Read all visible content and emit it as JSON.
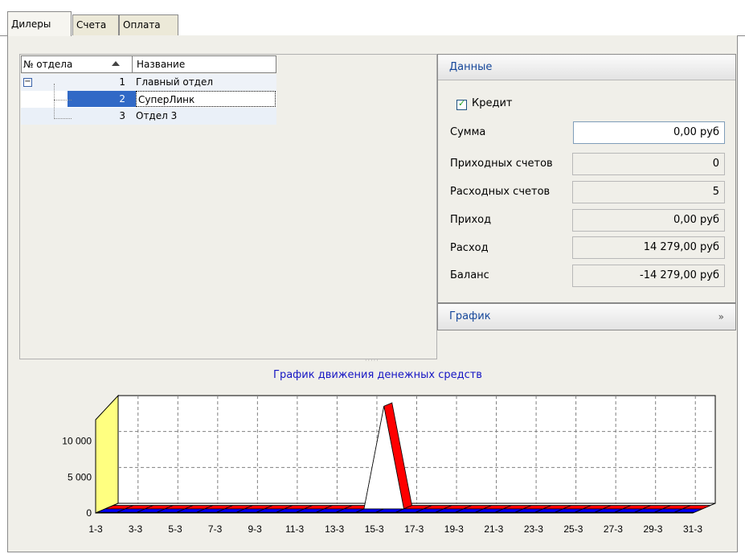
{
  "tabs": [
    "Дилеры",
    "Счета",
    "Оплата"
  ],
  "tree": {
    "columns": [
      "№ отдела",
      "Название"
    ],
    "rows": [
      {
        "num": "1",
        "name": "Главный отдел"
      },
      {
        "num": "2",
        "name": "СуперЛинк"
      },
      {
        "num": "3",
        "name": "Отдел 3"
      }
    ]
  },
  "data_group": {
    "title": "Данные",
    "credit_label": "Кредит",
    "fields": [
      {
        "label": "Сумма",
        "value": "0,00 руб"
      },
      {
        "label": "Приходных счетов",
        "value": "0"
      },
      {
        "label": "Расходных счетов",
        "value": "5"
      },
      {
        "label": "Приход",
        "value": "0,00 руб"
      },
      {
        "label": "Расход",
        "value": "14 279,00 руб"
      },
      {
        "label": "Баланс",
        "value": "-14 279,00 руб"
      }
    ]
  },
  "graph_group": {
    "title": "График"
  },
  "chart_data": {
    "type": "area",
    "title": "График движения денежных средств",
    "ylim": [
      0,
      15000
    ],
    "y_ticks": [
      "0",
      "5 000",
      "10 000"
    ],
    "categories": [
      "1-3",
      "2-3",
      "3-3",
      "4-3",
      "5-3",
      "6-3",
      "7-3",
      "8-3",
      "9-3",
      "10-3",
      "11-3",
      "12-3",
      "13-3",
      "14-3",
      "15-3",
      "16-3",
      "17-3",
      "18-3",
      "19-3",
      "20-3",
      "21-3",
      "22-3",
      "23-3",
      "24-3",
      "25-3",
      "26-3",
      "27-3",
      "28-3",
      "29-3",
      "30-3",
      "31-3"
    ],
    "x_tick_labels": [
      "1-3",
      "3-3",
      "5-3",
      "7-3",
      "9-3",
      "11-3",
      "13-3",
      "15-3",
      "17-3",
      "19-3",
      "21-3",
      "23-3",
      "25-3",
      "27-3",
      "29-3",
      "31-3"
    ],
    "series": [
      {
        "color": "#ff0000",
        "values": [
          0,
          0,
          0,
          0,
          0,
          0,
          0,
          0,
          0,
          0,
          0,
          0,
          0,
          0,
          14279,
          0,
          0,
          0,
          0,
          0,
          0,
          0,
          0,
          0,
          0,
          0,
          0,
          0,
          0,
          0,
          0
        ]
      },
      {
        "color": "#0000ff",
        "values": [
          0,
          0,
          0,
          0,
          0,
          0,
          0,
          0,
          0,
          0,
          0,
          0,
          0,
          0,
          0,
          0,
          0,
          0,
          0,
          0,
          0,
          0,
          0,
          0,
          0,
          0,
          0,
          0,
          0,
          0,
          0
        ]
      }
    ],
    "grid": true,
    "back_wall_color": "#ffff80"
  }
}
